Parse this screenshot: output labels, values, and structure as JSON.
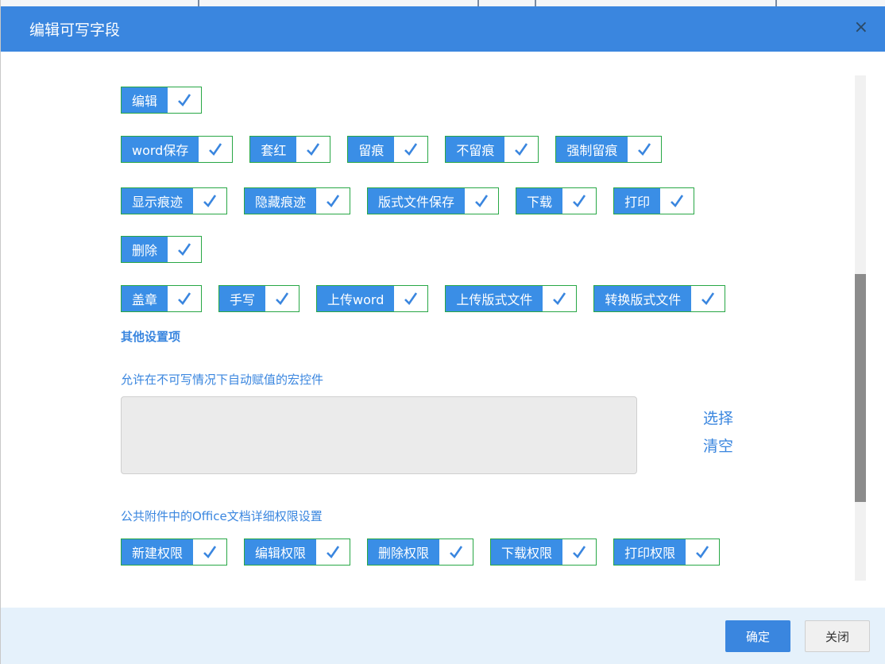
{
  "dialog": {
    "title": "编辑可写字段",
    "close_glyph": "×"
  },
  "rows": [
    [
      {
        "label": "编辑"
      }
    ],
    [
      {
        "label": "word保存"
      },
      {
        "label": "套红"
      },
      {
        "label": "留痕"
      },
      {
        "label": "不留痕"
      },
      {
        "label": "强制留痕"
      }
    ],
    [
      {
        "label": "显示痕迹"
      },
      {
        "label": "隐藏痕迹"
      },
      {
        "label": "版式文件保存"
      },
      {
        "label": "下载"
      },
      {
        "label": "打印"
      }
    ],
    [
      {
        "label": "删除"
      }
    ],
    [
      {
        "label": "盖章"
      },
      {
        "label": "手写"
      },
      {
        "label": "上传word"
      },
      {
        "label": "上传版式文件"
      },
      {
        "label": "转换版式文件"
      }
    ]
  ],
  "other_settings": {
    "title": "其他设置项"
  },
  "macro": {
    "label": "允许在不可写情况下自动赋值的宏控件",
    "select": "选择",
    "clear": "清空"
  },
  "office_perm": {
    "label": "公共附件中的Office文档详细权限设置",
    "items": [
      {
        "label": "新建权限"
      },
      {
        "label": "编辑权限"
      },
      {
        "label": "删除权限"
      },
      {
        "label": "下载权限"
      },
      {
        "label": "打印权限"
      }
    ]
  },
  "footer": {
    "ok": "确定",
    "close": "关闭"
  },
  "colors": {
    "header": "#3a86df",
    "chip": "#3a8ee6",
    "chip_border": "#28a745",
    "footer": "#e5f1fb"
  },
  "icons": {
    "check": "check-icon",
    "close": "close-icon"
  }
}
